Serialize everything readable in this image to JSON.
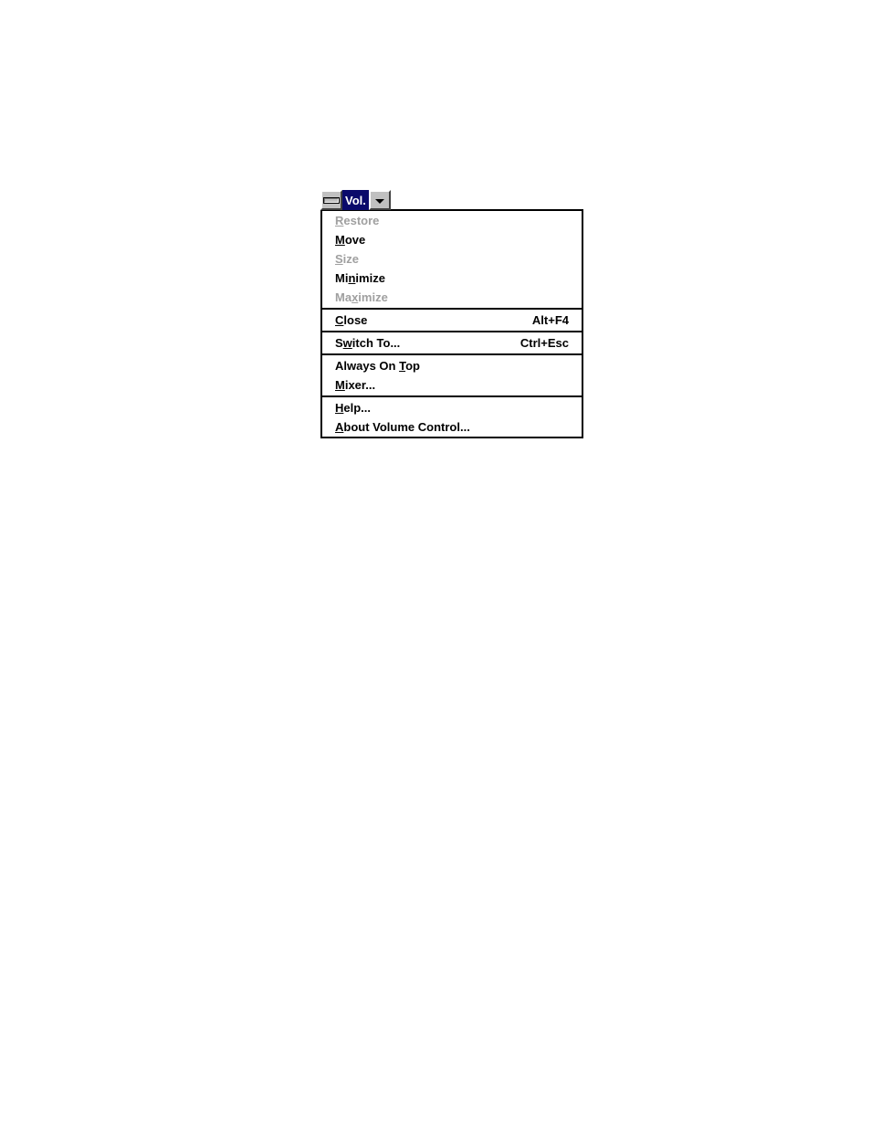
{
  "title": "Vol.",
  "menu": {
    "restore": {
      "pre": "",
      "u": "R",
      "post": "estore",
      "shortcut": "",
      "enabled": false
    },
    "move": {
      "pre": "",
      "u": "M",
      "post": "ove",
      "shortcut": "",
      "enabled": true
    },
    "size": {
      "pre": "",
      "u": "S",
      "post": "ize",
      "shortcut": "",
      "enabled": false
    },
    "minimize": {
      "pre": "Mi",
      "u": "n",
      "post": "imize",
      "shortcut": "",
      "enabled": true
    },
    "maximize": {
      "pre": "Ma",
      "u": "x",
      "post": "imize",
      "shortcut": "",
      "enabled": false
    },
    "close": {
      "pre": "",
      "u": "C",
      "post": "lose",
      "shortcut": "Alt+F4",
      "enabled": true
    },
    "switch": {
      "pre": "S",
      "u": "w",
      "post": "itch To...",
      "shortcut": "Ctrl+Esc",
      "enabled": true
    },
    "ontop": {
      "pre": "Always On ",
      "u": "T",
      "post": "op",
      "shortcut": "",
      "enabled": true
    },
    "mixer": {
      "pre": "",
      "u": "M",
      "post": "ixer...",
      "shortcut": "",
      "enabled": true
    },
    "help": {
      "pre": "",
      "u": "H",
      "post": "elp...",
      "shortcut": "",
      "enabled": true
    },
    "about": {
      "pre": "",
      "u": "A",
      "post": "bout Volume Control...",
      "shortcut": "",
      "enabled": true
    }
  }
}
